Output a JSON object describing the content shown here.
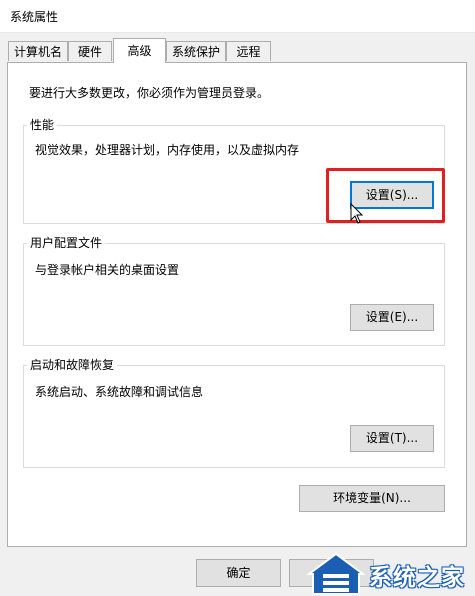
{
  "window": {
    "title": "系统属性"
  },
  "tabs": [
    {
      "label": "计算机名"
    },
    {
      "label": "硬件"
    },
    {
      "label": "高级"
    },
    {
      "label": "系统保护"
    },
    {
      "label": "远程"
    }
  ],
  "advanced": {
    "intro": "要进行大多数更改，你必须作为管理员登录。",
    "performance": {
      "legend": "性能",
      "description": "视觉效果，处理器计划，内存使用，以及虚拟内存",
      "settings_button": "设置(S)..."
    },
    "user_profiles": {
      "legend": "用户配置文件",
      "description": "与登录帐户相关的桌面设置",
      "settings_button": "设置(E)..."
    },
    "startup_recovery": {
      "legend": "启动和故障恢复",
      "description": "系统启动、系统故障和调试信息",
      "settings_button": "设置(T)..."
    },
    "env_button": "环境变量(N)..."
  },
  "footer": {
    "ok_button": "确定"
  },
  "watermark": {
    "text": "系统之家"
  },
  "colors": {
    "highlight": "#e02020",
    "focus": "#0078d7",
    "panel": "#ffffff",
    "window": "#f0f0f0"
  }
}
